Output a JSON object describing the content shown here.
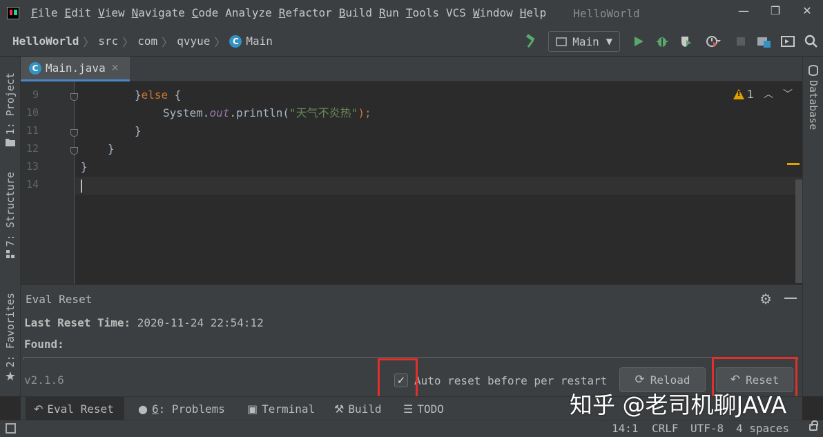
{
  "menu": {
    "items": [
      {
        "mnemonic": "F",
        "rest": "ile"
      },
      {
        "mnemonic": "E",
        "rest": "dit"
      },
      {
        "mnemonic": "V",
        "rest": "iew"
      },
      {
        "mnemonic": "N",
        "rest": "avigate"
      },
      {
        "mnemonic": "C",
        "rest": "ode"
      },
      {
        "mnemonic": "",
        "rest": "Analyze"
      },
      {
        "mnemonic": "R",
        "rest": "efactor"
      },
      {
        "mnemonic": "B",
        "rest": "uild"
      },
      {
        "mnemonic": "R",
        "rest": "un"
      },
      {
        "mnemonic": "T",
        "rest": "ools"
      },
      {
        "mnemonic": "",
        "rest": "VCS"
      },
      {
        "mnemonic": "W",
        "rest": "indow"
      },
      {
        "mnemonic": "H",
        "rest": "elp"
      }
    ],
    "window_title": "HelloWorld"
  },
  "breadcrumb": {
    "items": [
      "HelloWorld",
      "src",
      "com",
      "qvyue",
      "Main"
    ]
  },
  "toolbar": {
    "run_config": "Main"
  },
  "left_strip": {
    "project": "1: Project",
    "structure": "7: Structure",
    "favorites": "2: Favorites"
  },
  "right_strip": {
    "database": "Database"
  },
  "editor": {
    "tab_name": "Main.java",
    "line_numbers": [
      "9",
      "10",
      "11",
      "12",
      "13",
      "14"
    ],
    "code": {
      "line9_kw": "else",
      "line10_call": "System.",
      "line10_field": "out",
      "line10_method": ".println(",
      "line10_string": "\"天气不炎热\"",
      "line10_end": ");"
    },
    "warning_count": "1"
  },
  "panel": {
    "title": "Eval Reset",
    "last_reset_label": "Last Reset Time:",
    "last_reset_value": "2020-11-24 22:54:12",
    "found_label": "Found:",
    "version": "v2.1.6",
    "auto_reset_label": "Auto reset before per restart",
    "auto_reset_checked": true,
    "reload_label": "Reload",
    "reset_label": "Reset"
  },
  "bottom_tabs": {
    "eval_reset": "Eval Reset",
    "problems_num": "6",
    "problems": ": Problems",
    "terminal": "Terminal",
    "build": "Build",
    "todo": "TODO"
  },
  "watermark": "知乎 @老司机聊JAVA",
  "statusbar": {
    "position": "14:1",
    "line_sep": "CRLF",
    "encoding": "UTF-8",
    "indent": "4 spaces"
  },
  "colors": {
    "highlight": "#e0302c",
    "accent": "#4a88c7",
    "warning": "#e2a100"
  }
}
